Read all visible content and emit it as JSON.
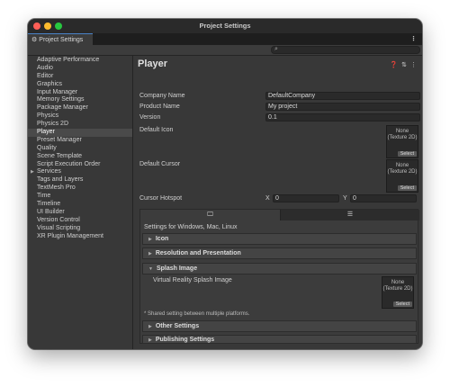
{
  "window": {
    "title": "Project Settings"
  },
  "tab": {
    "label": "Project Settings",
    "icon": "gear-icon"
  },
  "menu": {
    "more": "⋮"
  },
  "sidebar": {
    "items": [
      {
        "label": "Adaptive Performance"
      },
      {
        "label": "Audio"
      },
      {
        "label": "Editor"
      },
      {
        "label": "Graphics"
      },
      {
        "label": "Input Manager"
      },
      {
        "label": "Memory Settings"
      },
      {
        "label": "Package Manager"
      },
      {
        "label": "Physics"
      },
      {
        "label": "Physics 2D"
      },
      {
        "label": "Player",
        "selected": true
      },
      {
        "label": "Preset Manager"
      },
      {
        "label": "Quality"
      },
      {
        "label": "Scene Template"
      },
      {
        "label": "Script Execution Order"
      },
      {
        "label": "Services",
        "expandable": true
      },
      {
        "label": "Tags and Layers"
      },
      {
        "label": "TextMesh Pro"
      },
      {
        "label": "Time"
      },
      {
        "label": "Timeline"
      },
      {
        "label": "UI Builder"
      },
      {
        "label": "Version Control"
      },
      {
        "label": "Visual Scripting"
      },
      {
        "label": "XR Plugin Management"
      }
    ]
  },
  "player": {
    "title": "Player",
    "company_name_label": "Company Name",
    "company_name": "DefaultCompany",
    "product_name_label": "Product Name",
    "product_name": "My project",
    "version_label": "Version",
    "version": "0.1",
    "default_icon_label": "Default Icon",
    "default_cursor_label": "Default Cursor",
    "cursor_hotspot_label": "Cursor Hotspot",
    "hotspot_x_label": "X",
    "hotspot_x": "0",
    "hotspot_y_label": "Y",
    "hotspot_y": "0",
    "none_texture": "None\n(Texture 2D)",
    "none_line1": "None",
    "none_line2": "(Texture 2D)",
    "select_label": "Select"
  },
  "platform": {
    "settings_for": "Settings for Windows, Mac, Linux",
    "sections": {
      "icon": "Icon",
      "resolution": "Resolution and Presentation",
      "splash": "Splash Image",
      "other": "Other Settings",
      "publishing": "Publishing Settings"
    },
    "vr_splash_label": "Virtual Reality Splash Image",
    "shared_note": "* Shared setting between multiple platforms."
  },
  "colors": {
    "accent": "#4a82c8",
    "window_bg": "#383838",
    "titlebar_bg": "#2a2a2a"
  }
}
